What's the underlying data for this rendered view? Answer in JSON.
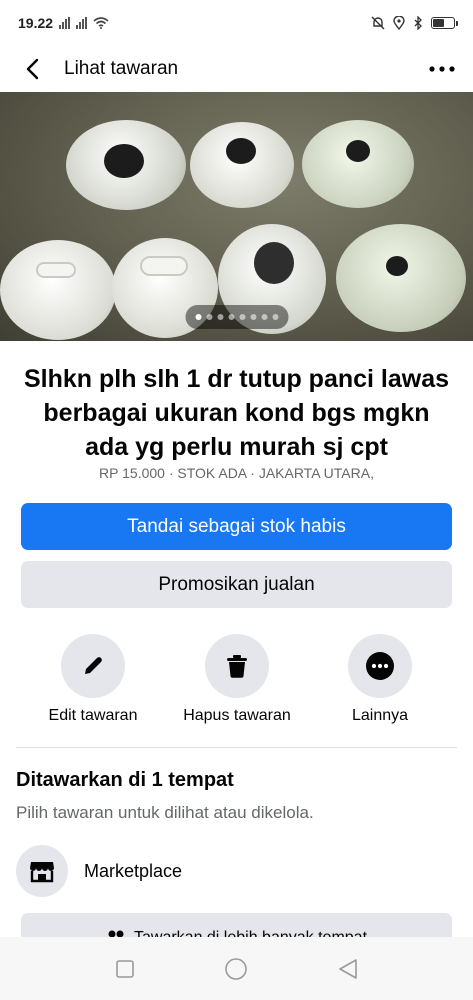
{
  "status_bar": {
    "time": "19.22"
  },
  "header": {
    "title": "Lihat tawaran",
    "back_icon": "arrow-left-icon",
    "more_icon": "more-horizontal-icon"
  },
  "gallery": {
    "photo_count": 8,
    "active_index": 0
  },
  "listing": {
    "title": "Slhkn plh slh 1 dr tutup panci lawas berbagai ukuran kond bgs mgkn ada yg perlu murah sj cpt",
    "meta": "RP 15.000 · STOK ADA · JAKARTA UTARA,"
  },
  "buttons": {
    "mark_sold": "Tandai sebagai stok habis",
    "promote": "Promosikan jualan"
  },
  "actions": [
    {
      "label": "Edit tawaran",
      "icon": "pencil-icon"
    },
    {
      "label": "Hapus tawaran",
      "icon": "trash-icon"
    },
    {
      "label": "Lainnya",
      "icon": "more-circle-icon"
    }
  ],
  "offered": {
    "title": "Ditawarkan di 1 tempat",
    "subtitle": "Pilih tawaran untuk dilihat atau dikelola.",
    "place_label": "Marketplace",
    "place_icon": "storefront-icon",
    "more_places_label": "Tawarkan di lebih banyak tempat"
  },
  "colors": {
    "primary": "#1877f2",
    "secondary_bg": "#e4e6eb",
    "muted_text": "#65676b"
  }
}
